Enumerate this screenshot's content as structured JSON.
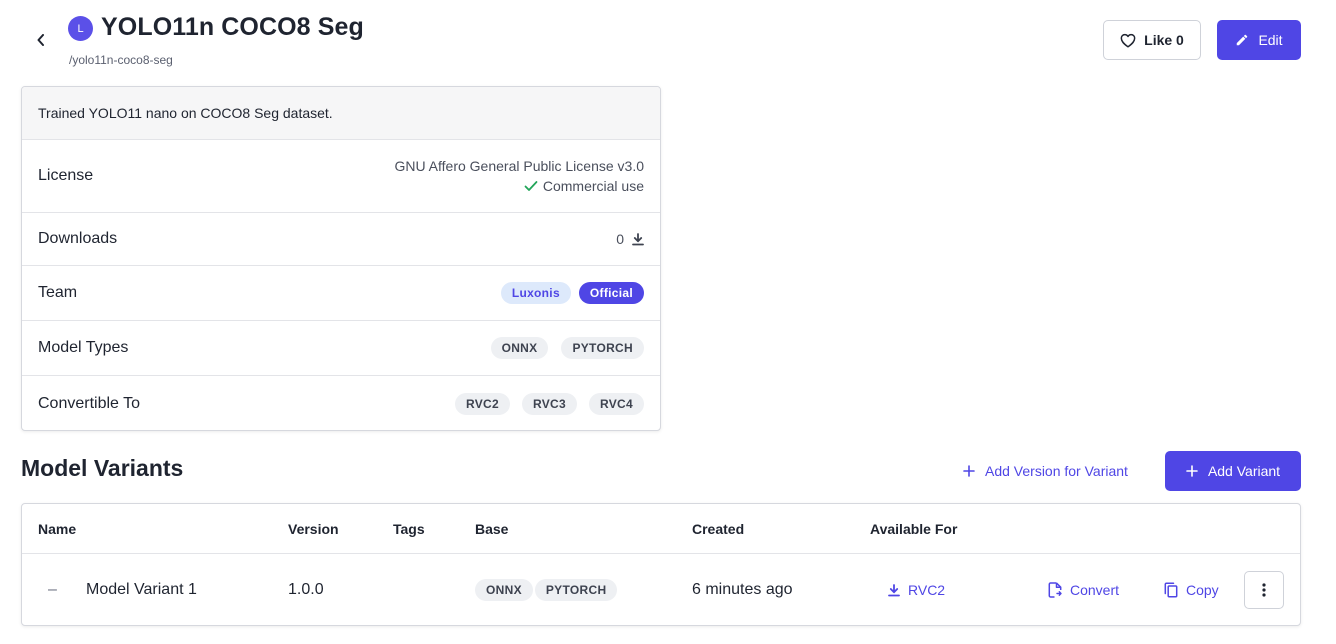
{
  "header": {
    "avatar_letter": "L",
    "title": "YOLO11n COCO8 Seg",
    "slug": "/yolo11n-coco8-seg",
    "like_label": "Like 0",
    "edit_label": "Edit"
  },
  "info": {
    "description": "Trained YOLO11 nano on COCO8 Seg dataset.",
    "license_label": "License",
    "license_value": "GNU Affero General Public License v3.0",
    "commercial_label": "Commercial use",
    "downloads_label": "Downloads",
    "downloads_value": "0",
    "team_label": "Team",
    "team_badges": [
      "Luxonis",
      "Official"
    ],
    "model_types_label": "Model Types",
    "model_types": [
      "ONNX",
      "PYTORCH"
    ],
    "convertible_label": "Convertible To",
    "convertible": [
      "RVC2",
      "RVC3",
      "RVC4"
    ]
  },
  "variants": {
    "title": "Model Variants",
    "add_version_label": "Add Version for Variant",
    "add_variant_label": "Add Variant",
    "columns": [
      "Name",
      "Version",
      "Tags",
      "Base",
      "Created",
      "Available For"
    ],
    "rows": [
      {
        "collapse_symbol": "–",
        "name": "Model Variant 1",
        "version": "1.0.0",
        "base": [
          "ONNX",
          "PYTORCH"
        ],
        "created": "6 minutes ago",
        "available": "RVC2",
        "convert_label": "Convert",
        "copy_label": "Copy"
      }
    ]
  },
  "colors": {
    "accent": "#4f46e5",
    "check_green": "#22a559"
  },
  "icons": [
    "chevron-left-icon",
    "heart-icon",
    "pencil-icon",
    "check-icon",
    "download-icon",
    "plus-icon",
    "convert-icon",
    "copy-icon",
    "more-vertical-icon"
  ]
}
